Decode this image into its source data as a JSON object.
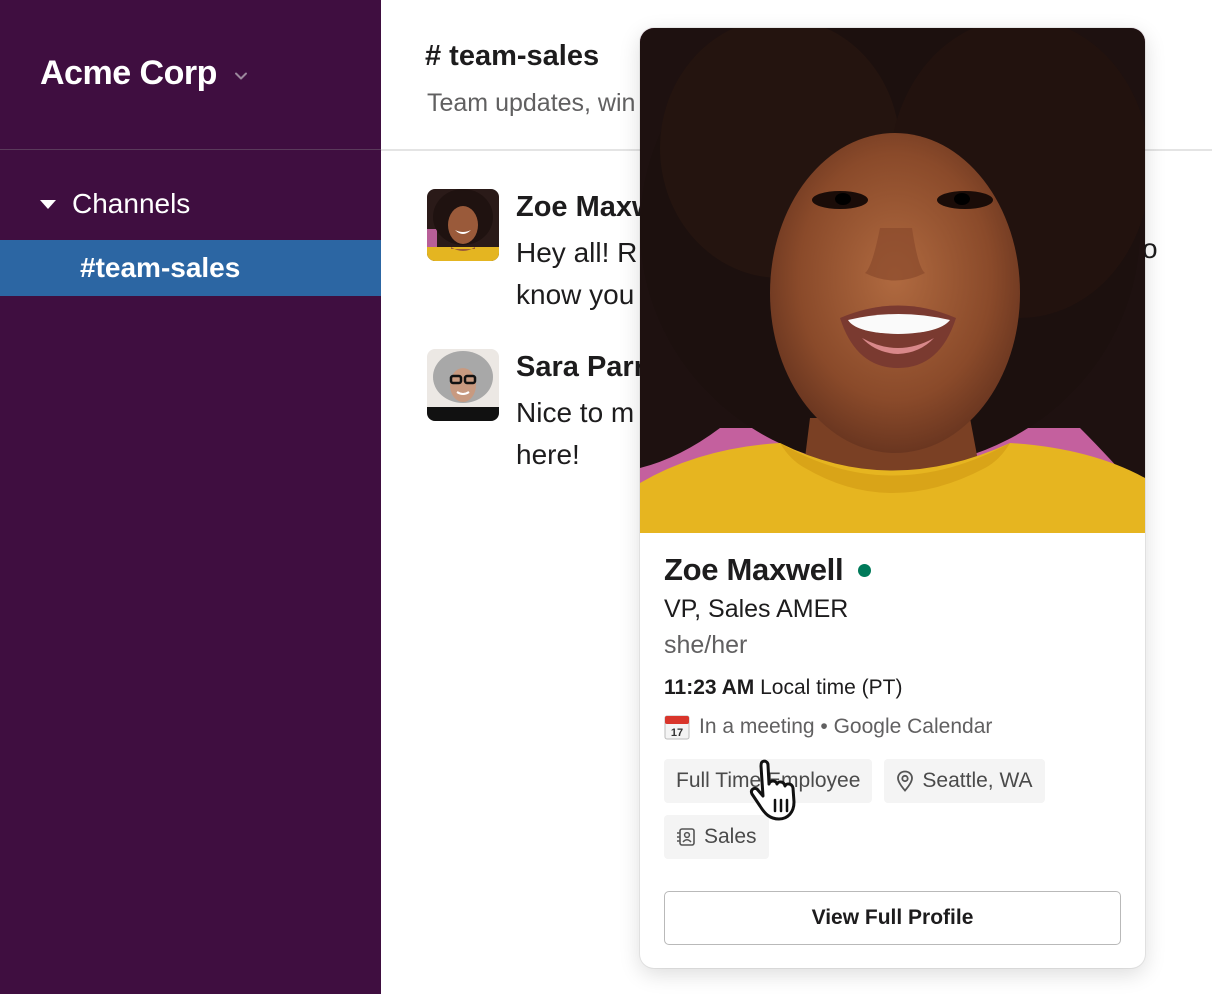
{
  "workspace": {
    "name": "Acme Corp",
    "menu_icon": "chevron-down-icon"
  },
  "sidebar": {
    "section_label": "Channels",
    "section_icon": "caret-down-icon",
    "channels": [
      {
        "label": "#team-sales",
        "selected": true
      }
    ]
  },
  "channel": {
    "title": "# team-sales",
    "topic": "Team updates, win"
  },
  "messages": [
    {
      "author": "Zoe Maxw",
      "lines": [
        "Hey all! R",
        "know you"
      ],
      "avatar": "zoe-avatar"
    },
    {
      "author": "Sara Parr",
      "lines": [
        "Nice to m",
        "here!"
      ],
      "avatar": "sara-avatar"
    }
  ],
  "overflow_text": "o",
  "profile_card": {
    "name": "Zoe Maxwell",
    "presence": "active",
    "presence_color": "#007a5a",
    "title": "VP, Sales AMER",
    "pronouns": "she/her",
    "local_time": "11:23 AM",
    "local_time_suffix": " Local time (PT)",
    "status_icon": "calendar-icon",
    "status_calendar_day": "17",
    "status_text": "In a meeting • Google Calendar",
    "tags": [
      {
        "label": "Full Time Employee",
        "icon": null
      },
      {
        "label": "Seattle, WA",
        "icon": "location-pin-icon"
      },
      {
        "label": "Sales",
        "icon": "contact-card-icon"
      }
    ],
    "button_label": "View Full Profile"
  },
  "colors": {
    "sidebar_bg": "#3f0e40",
    "selected_channel_bg": "#2c66a3",
    "photo_bg_pink": "#c4609e",
    "sweater_yellow": "#e6b520"
  }
}
